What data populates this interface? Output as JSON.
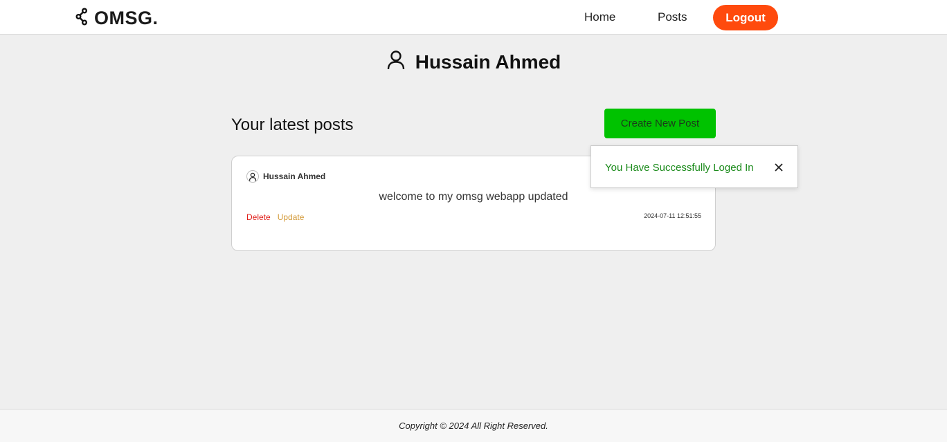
{
  "nav": {
    "brand": "OMSG.",
    "brand_icon": "share-icon",
    "links": [
      {
        "label": "Home"
      },
      {
        "label": "Posts"
      }
    ],
    "logout_label": "Logout",
    "logout_color": "#ff4a0d"
  },
  "profile": {
    "name": "Hussain Ahmed",
    "icon": "user-icon"
  },
  "posts_section": {
    "title": "Your latest posts",
    "create_label": "Create New Post",
    "create_color": "#00c200"
  },
  "posts": [
    {
      "author": "Hussain Ahmed",
      "content": "welcome to my omsg webapp updated",
      "delete_label": "Delete",
      "update_label": "Update",
      "date": "2024-07-11 12:51:55"
    }
  ],
  "toast": {
    "message": "You Have Successfully Loged In",
    "close_icon": "close-icon",
    "color": "#1a8a1a"
  },
  "footer": {
    "text": "Copyright © 2024 All Right Reserved."
  }
}
